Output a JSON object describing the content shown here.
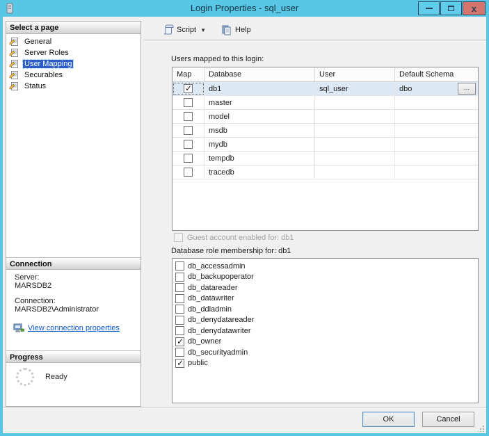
{
  "window": {
    "title": "Login Properties - sql_user",
    "close_glyph": "x"
  },
  "sidebar": {
    "select_page_header": "Select a page",
    "pages": [
      {
        "label": "General",
        "selected": false
      },
      {
        "label": "Server Roles",
        "selected": false
      },
      {
        "label": "User Mapping",
        "selected": true
      },
      {
        "label": "Securables",
        "selected": false
      },
      {
        "label": "Status",
        "selected": false
      }
    ],
    "connection_header": "Connection",
    "server_label": "Server:",
    "server_value": "MARSDB2",
    "connection_label": "Connection:",
    "connection_value": "MARSDB2\\Administrator",
    "view_connection_link": "View connection properties",
    "progress_header": "Progress",
    "progress_status": "Ready"
  },
  "toolbar": {
    "script_label": "Script",
    "caret_glyph": "▼",
    "help_label": "Help"
  },
  "mapping": {
    "section_label": "Users mapped to this login:",
    "columns": [
      "Map",
      "Database",
      "User",
      "Default Schema"
    ],
    "rows": [
      {
        "map": true,
        "database": "db1",
        "user": "sql_user",
        "schema": "dbo",
        "selected": true,
        "browse": "..."
      },
      {
        "map": false,
        "database": "master",
        "user": "",
        "schema": "",
        "selected": false
      },
      {
        "map": false,
        "database": "model",
        "user": "",
        "schema": "",
        "selected": false
      },
      {
        "map": false,
        "database": "msdb",
        "user": "",
        "schema": "",
        "selected": false
      },
      {
        "map": false,
        "database": "mydb",
        "user": "",
        "schema": "",
        "selected": false
      },
      {
        "map": false,
        "database": "tempdb",
        "user": "",
        "schema": "",
        "selected": false
      },
      {
        "map": false,
        "database": "tracedb",
        "user": "",
        "schema": "",
        "selected": false
      }
    ]
  },
  "guest": {
    "label": "Guest account enabled for: db1",
    "checked": false,
    "enabled": false
  },
  "roles": {
    "section_label": "Database role membership for: db1",
    "items": [
      {
        "label": "db_accessadmin",
        "checked": false
      },
      {
        "label": "db_backupoperator",
        "checked": false
      },
      {
        "label": "db_datareader",
        "checked": false
      },
      {
        "label": "db_datawriter",
        "checked": false
      },
      {
        "label": "db_ddladmin",
        "checked": false
      },
      {
        "label": "db_denydatareader",
        "checked": false
      },
      {
        "label": "db_denydatawriter",
        "checked": false
      },
      {
        "label": "db_owner",
        "checked": true
      },
      {
        "label": "db_securityadmin",
        "checked": false
      },
      {
        "label": "public",
        "checked": true
      }
    ]
  },
  "footer": {
    "ok_label": "OK",
    "cancel_label": "Cancel"
  },
  "colors": {
    "titlebar": "#58c7e6",
    "close_button": "#d3756c",
    "selection_blue": "#2b5ec9",
    "row_highlight": "#dce9f5",
    "link_blue": "#0b5bd3"
  }
}
